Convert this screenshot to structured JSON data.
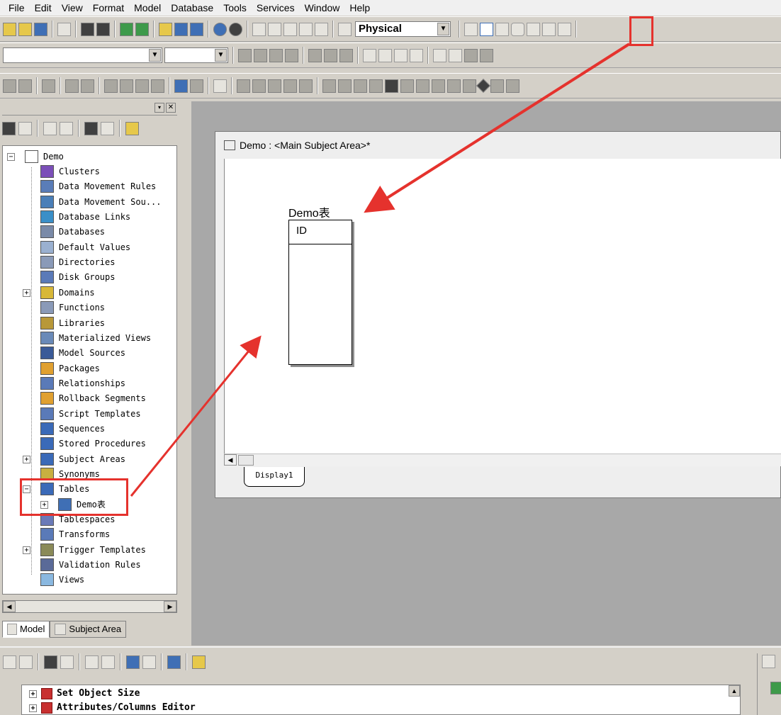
{
  "menu": [
    "File",
    "Edit",
    "View",
    "Format",
    "Model",
    "Database",
    "Tools",
    "Services",
    "Window",
    "Help"
  ],
  "toolbar": {
    "view_mode": "Physical"
  },
  "tree": {
    "root": "Demo",
    "items": [
      {
        "label": "Clusters",
        "expandable": false
      },
      {
        "label": "Data Movement Rules",
        "expandable": false
      },
      {
        "label": "Data Movement Sou...",
        "expandable": false
      },
      {
        "label": "Database Links",
        "expandable": false
      },
      {
        "label": "Databases",
        "expandable": false
      },
      {
        "label": "Default Values",
        "expandable": false
      },
      {
        "label": "Directories",
        "expandable": false
      },
      {
        "label": "Disk Groups",
        "expandable": false
      },
      {
        "label": "Domains",
        "expandable": true
      },
      {
        "label": "Functions",
        "expandable": false
      },
      {
        "label": "Libraries",
        "expandable": false
      },
      {
        "label": "Materialized Views",
        "expandable": false
      },
      {
        "label": "Model Sources",
        "expandable": false
      },
      {
        "label": "Packages",
        "expandable": false
      },
      {
        "label": "Relationships",
        "expandable": false
      },
      {
        "label": "Rollback Segments",
        "expandable": false
      },
      {
        "label": "Script Templates",
        "expandable": false
      },
      {
        "label": "Sequences",
        "expandable": false
      },
      {
        "label": "Stored Procedures",
        "expandable": false
      },
      {
        "label": "Subject Areas",
        "expandable": true
      },
      {
        "label": "Synonyms",
        "expandable": false
      },
      {
        "label": "Tables",
        "expandable": true,
        "expanded": true
      },
      {
        "label": "Demo表",
        "expandable": true,
        "child": true
      },
      {
        "label": "Tablespaces",
        "expandable": false
      },
      {
        "label": "Transforms",
        "expandable": false
      },
      {
        "label": "Trigger Templates",
        "expandable": true
      },
      {
        "label": "Validation Rules",
        "expandable": false
      },
      {
        "label": "Views",
        "expandable": false
      }
    ]
  },
  "left_tabs": [
    "Model",
    "Subject Area"
  ],
  "diagram": {
    "window_title": "Demo : <Main Subject Area>*",
    "entity_name": "Demo表",
    "entity_column": "ID",
    "display_tab": "Display1"
  },
  "bottom": {
    "items": [
      "Set Object Size",
      "Attributes/Columns Editor"
    ]
  },
  "colors": {
    "highlight": "#e5322d",
    "tree_icon": "#3f6fb5"
  }
}
